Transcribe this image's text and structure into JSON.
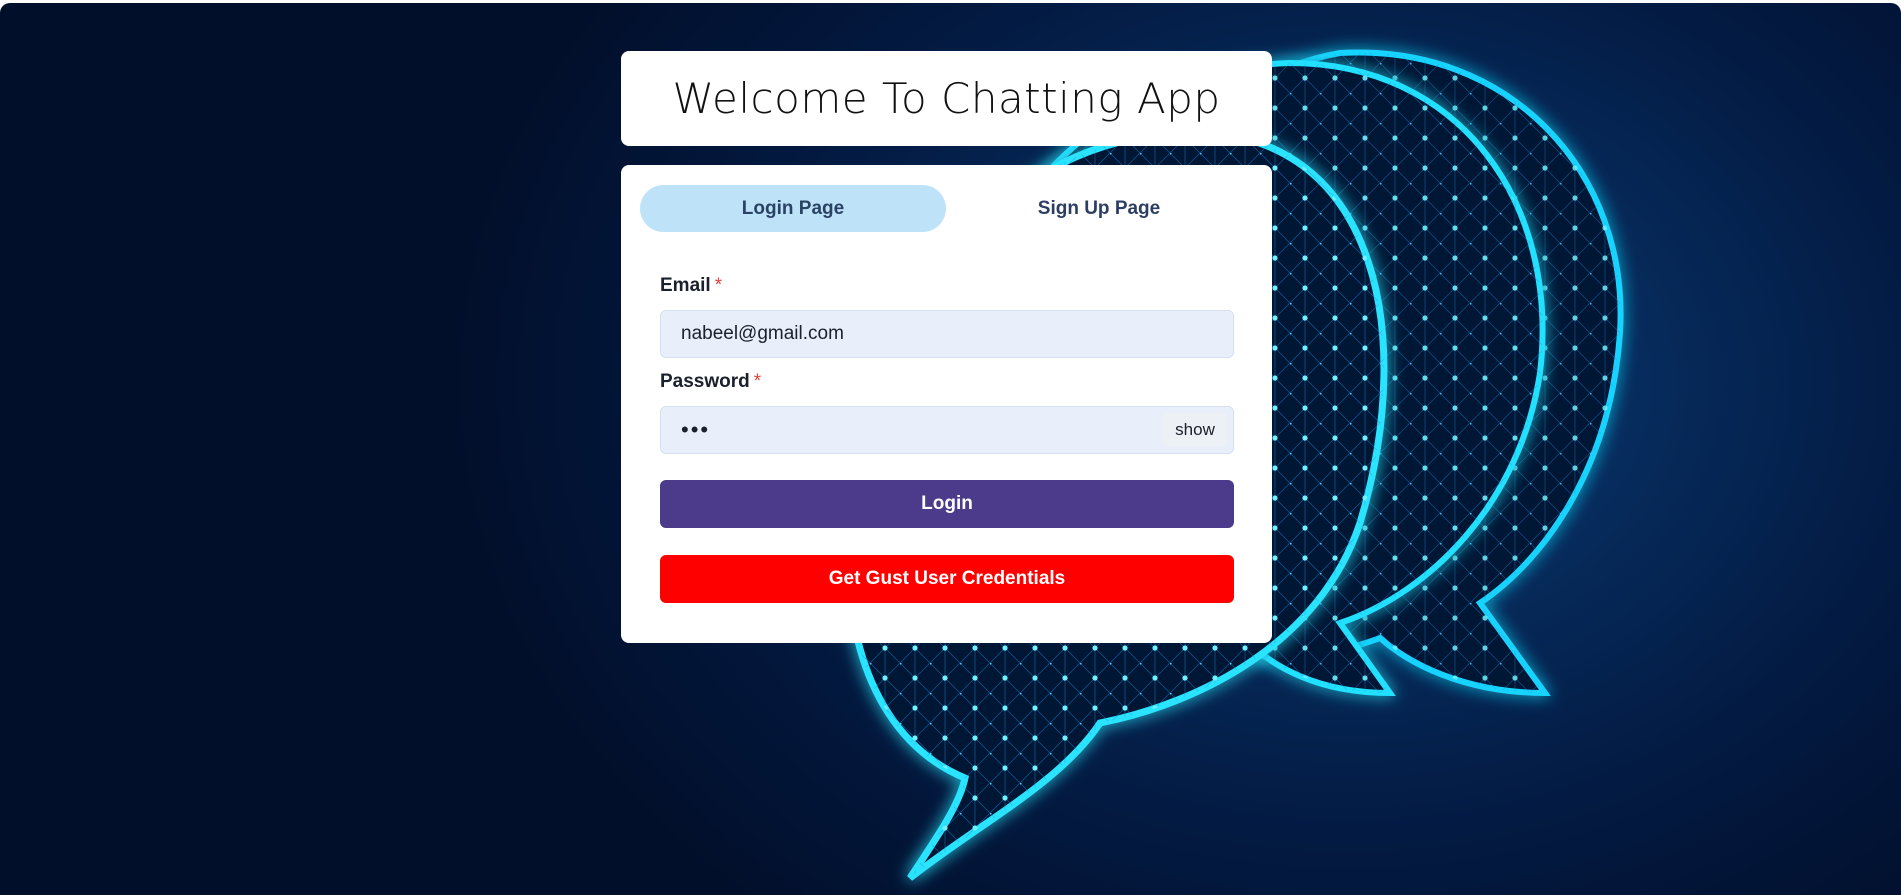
{
  "title": "Welcome To Chatting App",
  "tabs": {
    "login": "Login Page",
    "signup": "Sign Up Page"
  },
  "form": {
    "email_label": "Email",
    "email_value": "nabeel@gmail.com",
    "password_label": "Password",
    "password_value": "•••",
    "required_marker": "*",
    "show_label": "show"
  },
  "buttons": {
    "login": "Login",
    "guest": "Get Gust User Credentials"
  },
  "colors": {
    "login_button": "#4b3b8a",
    "guest_button": "#ff0000",
    "active_tab": "#bee3f8"
  }
}
